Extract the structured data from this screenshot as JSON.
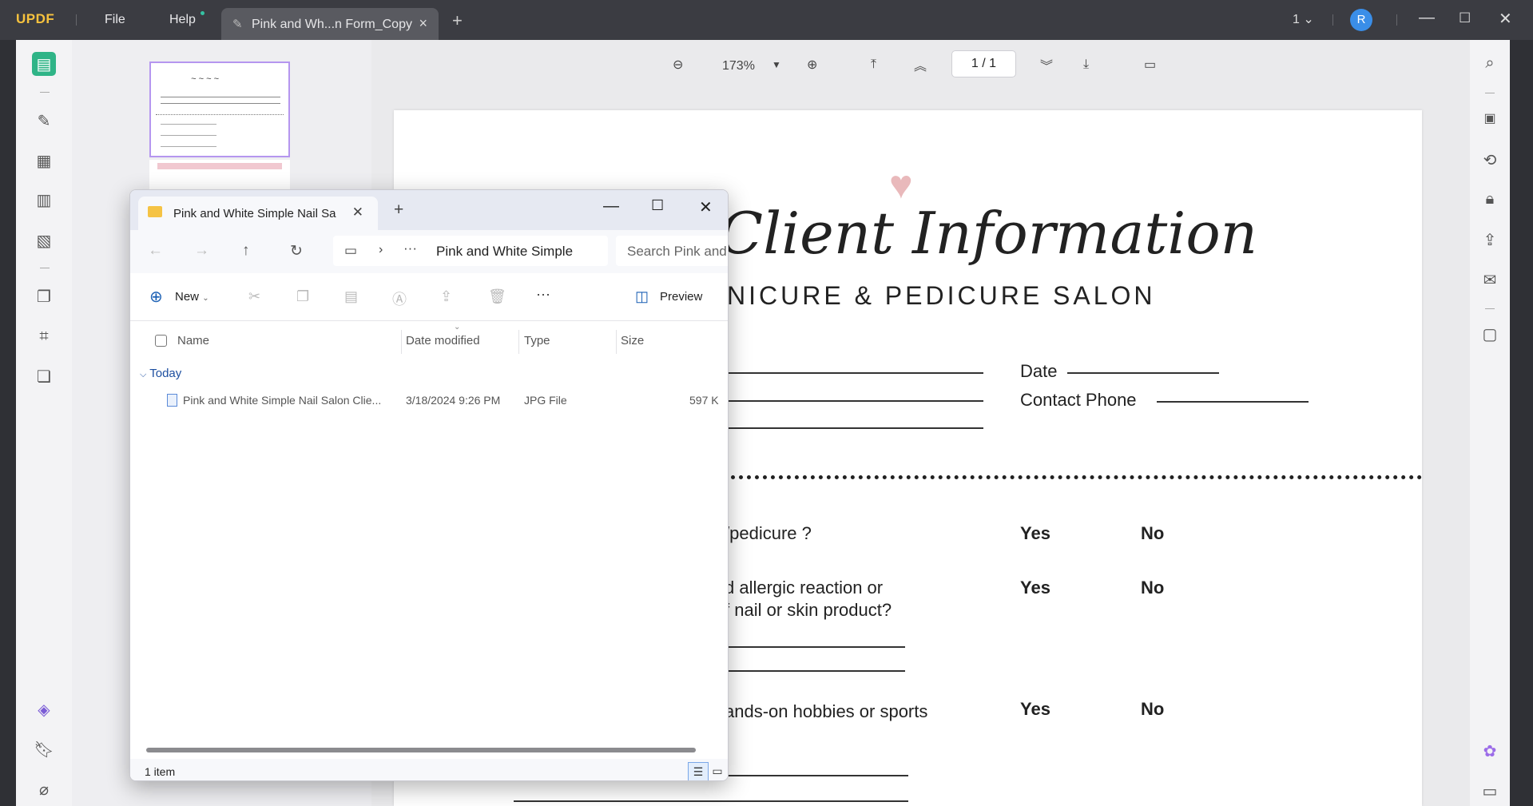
{
  "app": {
    "logo": "UPDF",
    "menu_file": "File",
    "menu_help": "Help",
    "tab_title": "Pink and Wh...n Form_Copy",
    "page_indicator": "1",
    "avatar_letter": "R"
  },
  "toolbar": {
    "zoom": "173%",
    "page_current": "1",
    "page_sep": "/",
    "page_total": "1"
  },
  "document": {
    "title": "Client Information",
    "subtitle": "NICURE & PEDICURE SALON",
    "date_label": "Date",
    "phone_label": "Contact Phone",
    "q1": "/pedicure ?",
    "q2a": "d allergic reaction or",
    "q2b": "f nail or skin product?",
    "q3": "ands-on hobbies or sports",
    "yes": "Yes",
    "no": "No"
  },
  "explorer": {
    "tab_title": "Pink and White Simple Nail Sa",
    "address": "Pink and White Simple",
    "search_placeholder": "Search Pink and",
    "new_label": "New",
    "preview_label": "Preview",
    "columns": [
      "Name",
      "Date modified",
      "Type",
      "Size"
    ],
    "group": "Today",
    "files": [
      {
        "name": "Pink and White Simple Nail Salon Clie...",
        "date": "3/18/2024 9:26 PM",
        "type": "JPG File",
        "size": "597 K"
      }
    ],
    "status": "1 item"
  }
}
